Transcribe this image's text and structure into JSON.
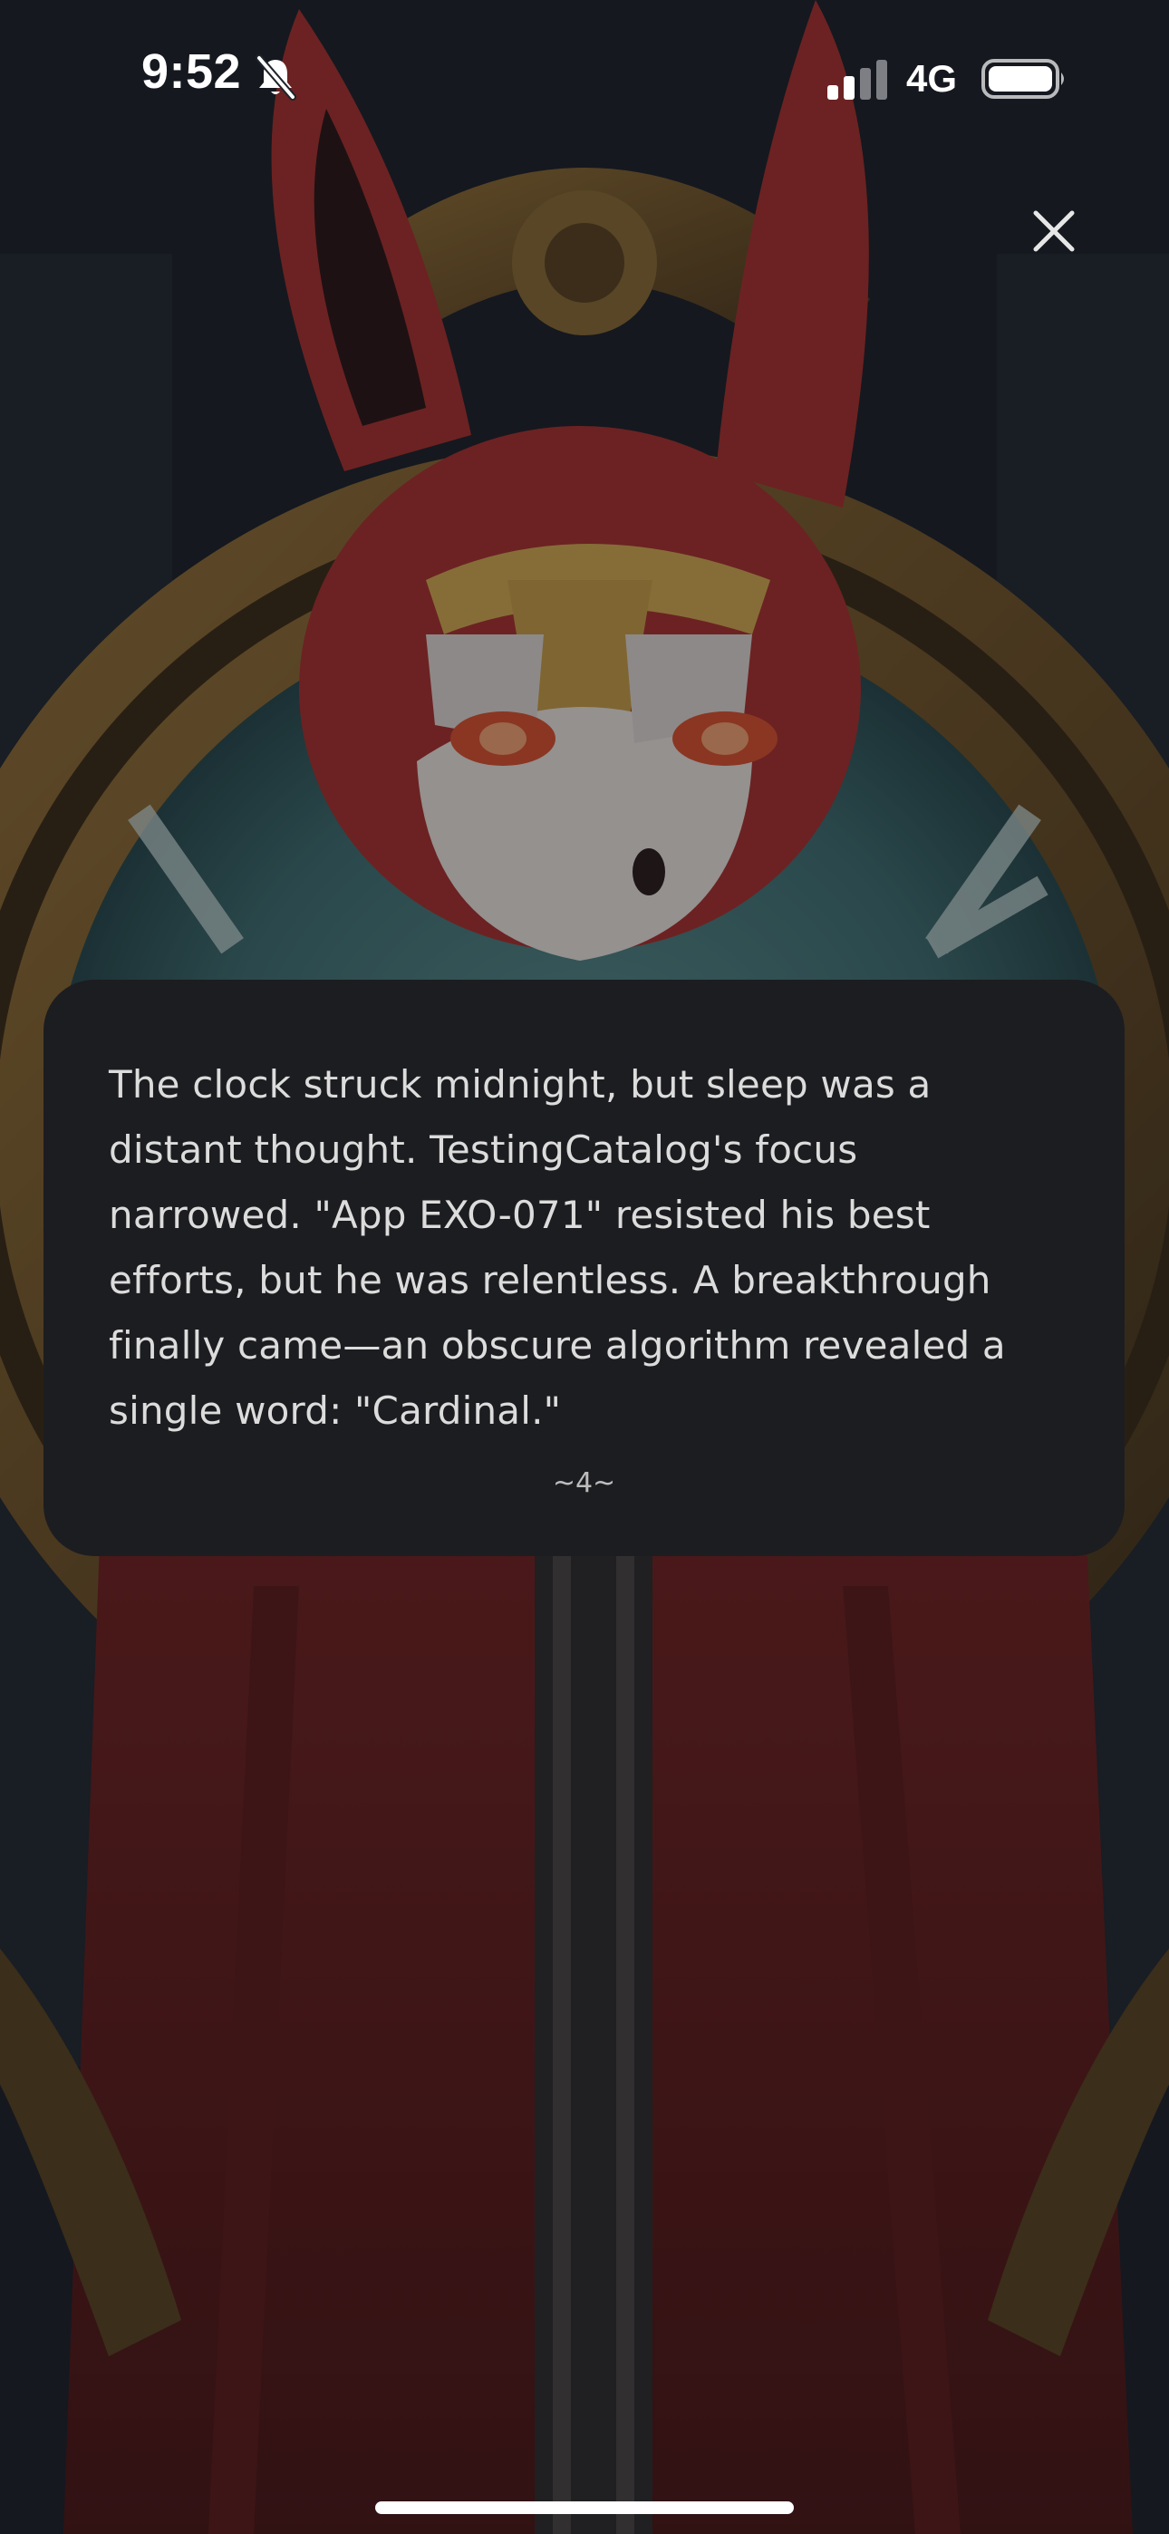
{
  "status_bar": {
    "time": "9:52",
    "network": "4G",
    "icons": [
      "bell-slash-icon",
      "cellular-signal-icon",
      "battery-icon"
    ]
  },
  "close_button": {
    "icon": "close-icon"
  },
  "story": {
    "text": "The clock struck midnight, but sleep was a distant thought. TestingCatalog's focus narrowed. \"App EXO-071\" resisted his best efforts, but he was relentless. A breakthrough finally came—an obscure algorithm revealed a single word: \"Cardinal.\"",
    "page": "~4~"
  },
  "colors": {
    "card_background": "#1c1d20",
    "story_text": "#dcdcdc",
    "fur_red": "#a8302c",
    "frame_gold": "#7a5a2c",
    "clock_face_teal": "#3f6e70"
  }
}
